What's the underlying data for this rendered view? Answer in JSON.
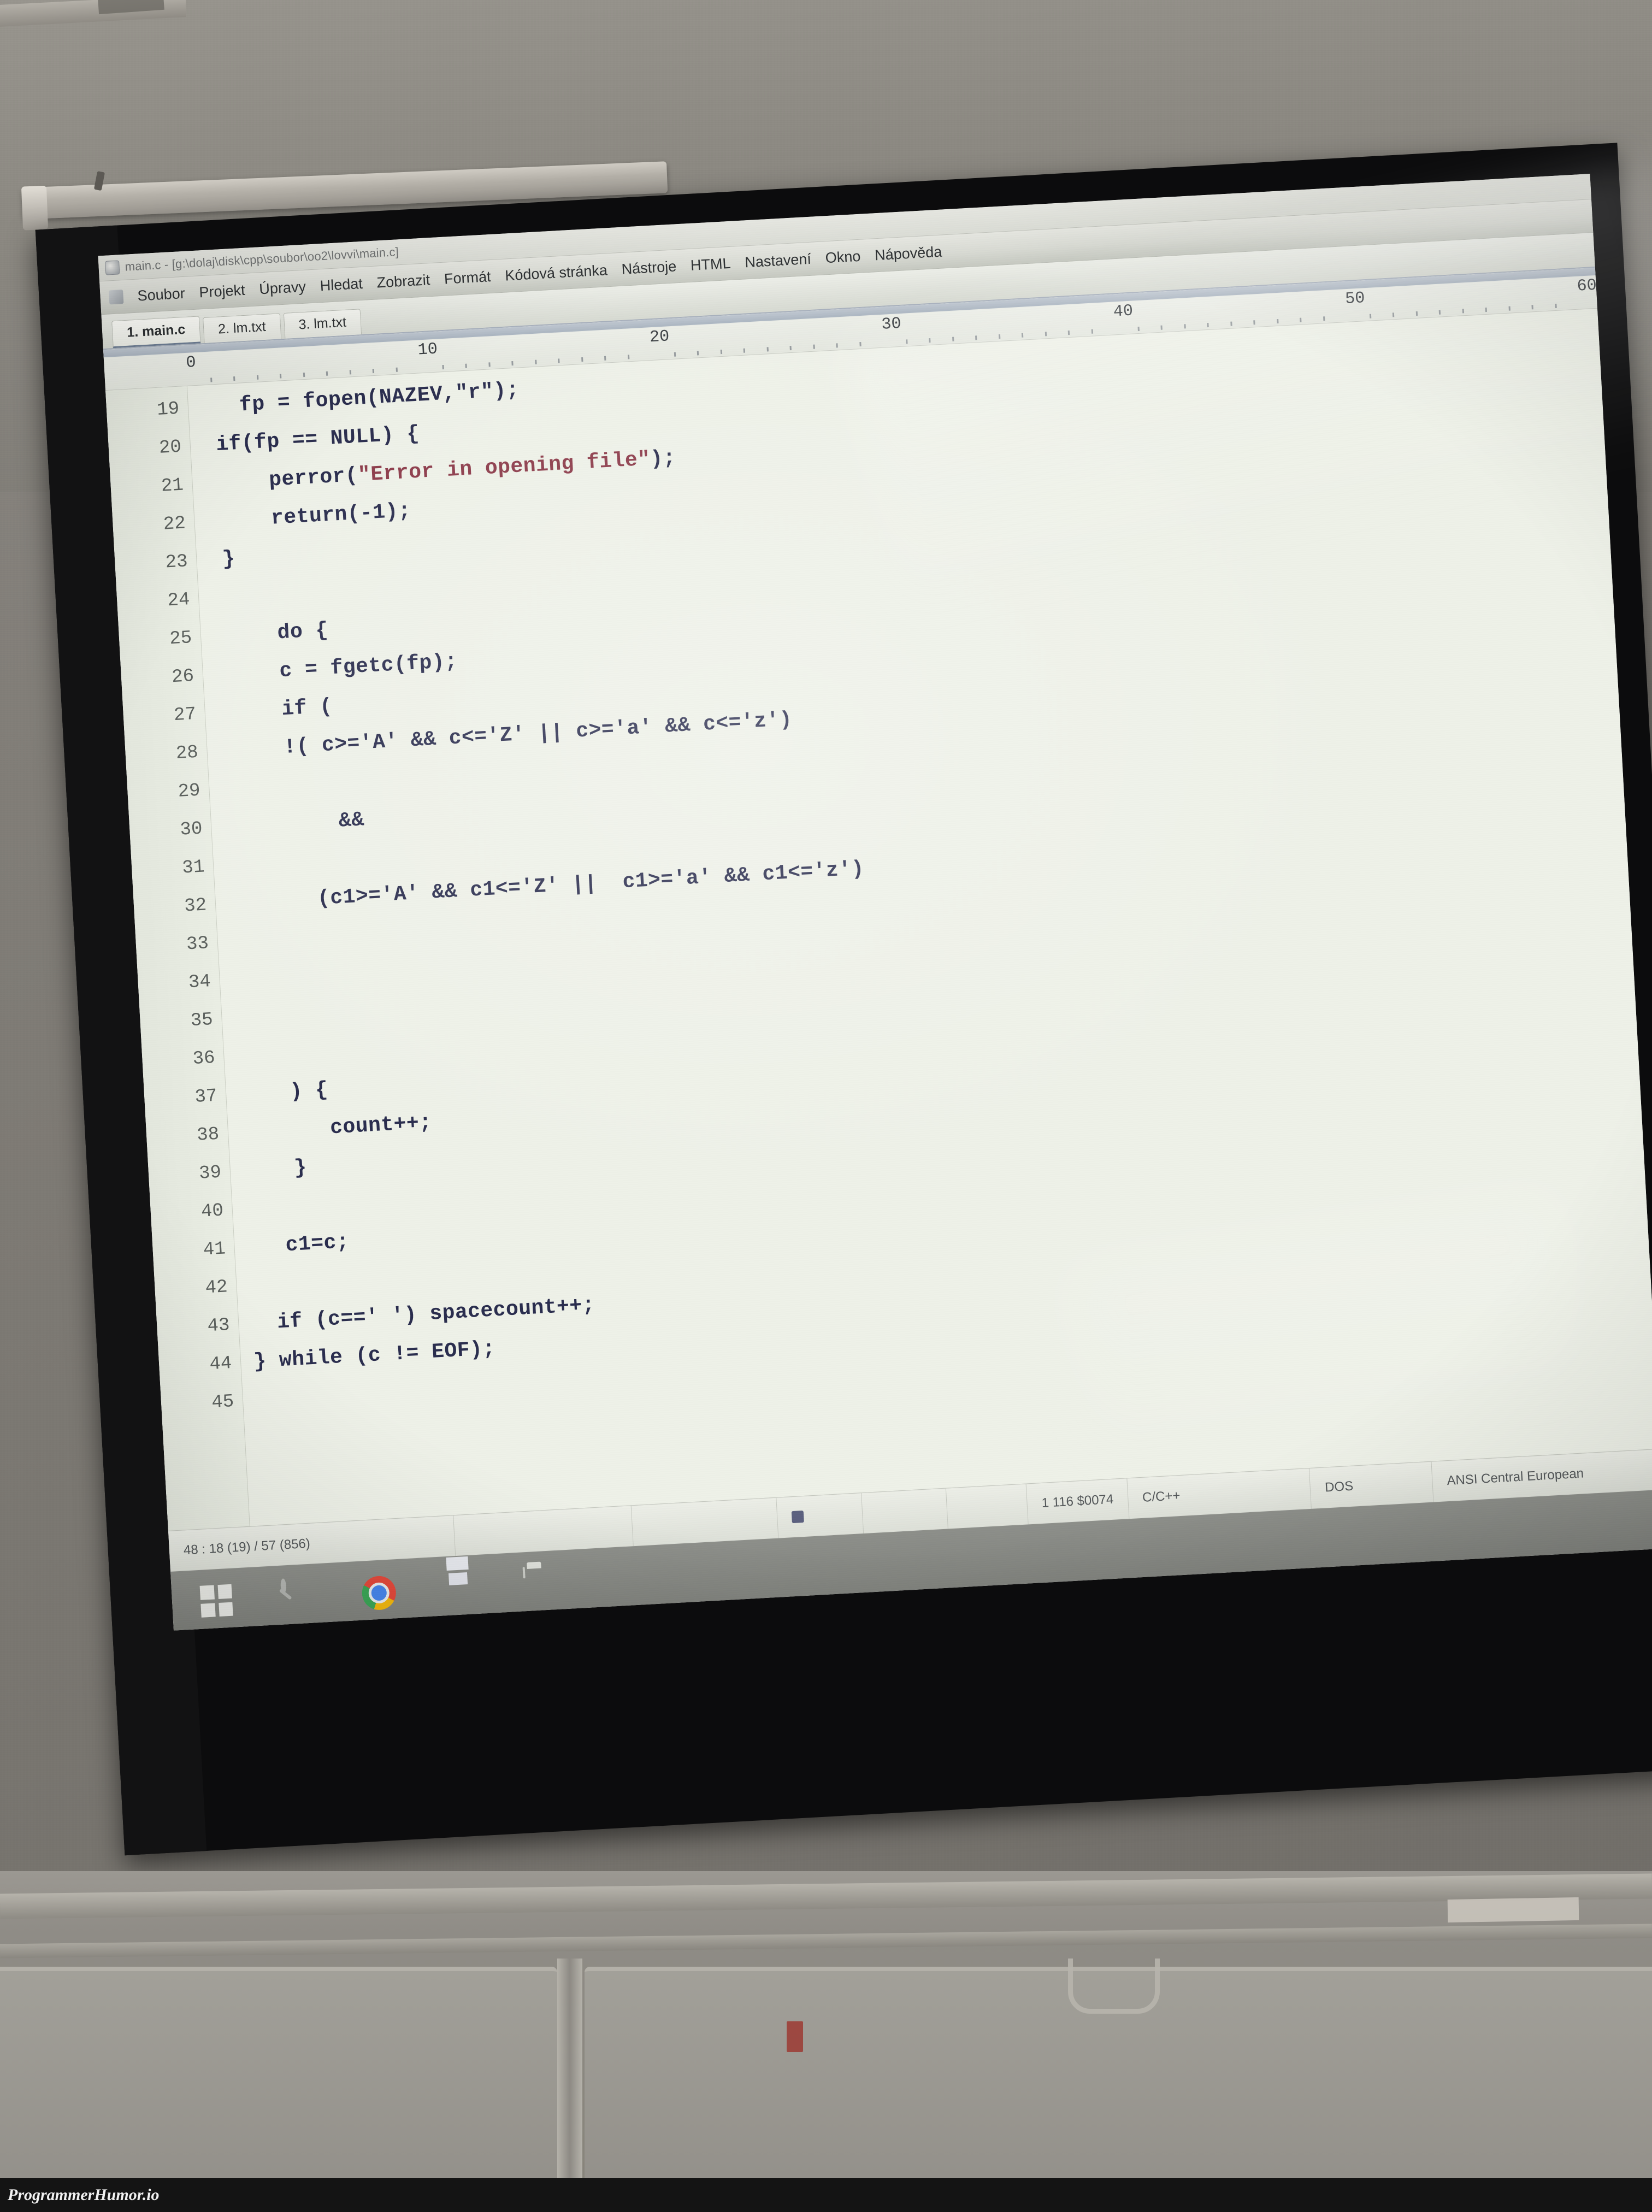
{
  "scene": {
    "description": "photo of a projector screen in a classroom showing PSPad editor",
    "watermark": "ProgrammerHumor.io"
  },
  "window": {
    "title": "main.c - [g:\\dolaj\\disk\\cpp\\soubor\\oo2\\lovvi\\main.c]",
    "icon": "pspad-icon"
  },
  "menubar": {
    "icon": "app-menu-icon",
    "items": [
      {
        "label": "Soubor"
      },
      {
        "label": "Projekt"
      },
      {
        "label": "Úpravy"
      },
      {
        "label": "Hledat"
      },
      {
        "label": "Zobrazit"
      },
      {
        "label": "Formát"
      },
      {
        "label": "Kódová stránka"
      },
      {
        "label": "Nástroje"
      },
      {
        "label": "HTML"
      },
      {
        "label": "Nastavení"
      },
      {
        "label": "Okno"
      },
      {
        "label": "Nápověda"
      }
    ]
  },
  "tabs": [
    {
      "label": "1. main.c",
      "active": true
    },
    {
      "label": "2. lm.txt",
      "active": false
    },
    {
      "label": "3. lm.txt",
      "active": false
    }
  ],
  "ruler": {
    "ticks": [
      "0",
      "10",
      "20",
      "30",
      "40",
      "50",
      "60"
    ]
  },
  "editor": {
    "lines": [
      {
        "num": "19",
        "text": "    fp = fopen(NAZEV,\"r\");"
      },
      {
        "num": "20",
        "text": "  if(fp == NULL) {"
      },
      {
        "num": "21",
        "text": "      perror(\"Error in opening file\");",
        "string_from": 13,
        "string_to": 36
      },
      {
        "num": "22",
        "text": "      return(-1);"
      },
      {
        "num": "23",
        "text": "  }"
      },
      {
        "num": "24",
        "text": ""
      },
      {
        "num": "25",
        "text": "      do {"
      },
      {
        "num": "26",
        "text": "      c = fgetc(fp);"
      },
      {
        "num": "27",
        "text": "      if ("
      },
      {
        "num": "28",
        "text": "      !( c>='A' && c<='Z' || c>='a' && c<='z')"
      },
      {
        "num": "29",
        "text": ""
      },
      {
        "num": "30",
        "text": "          &&"
      },
      {
        "num": "31",
        "text": ""
      },
      {
        "num": "32",
        "text": "        (c1>='A' && c1<='Z' ||  c1>='a' && c1<='z')"
      },
      {
        "num": "33",
        "text": ""
      },
      {
        "num": "34",
        "text": ""
      },
      {
        "num": "35",
        "text": ""
      },
      {
        "num": "36",
        "text": ""
      },
      {
        "num": "37",
        "text": "     ) {"
      },
      {
        "num": "38",
        "text": "        count++;"
      },
      {
        "num": "39",
        "text": "     }"
      },
      {
        "num": "40",
        "text": ""
      },
      {
        "num": "41",
        "text": "    c1=c;"
      },
      {
        "num": "42",
        "text": ""
      },
      {
        "num": "43",
        "text": "   if (c==' ') spacecount++;"
      },
      {
        "num": "44",
        "text": " } while (c != EOF);"
      },
      {
        "num": "45",
        "text": ""
      }
    ]
  },
  "statusbar": {
    "cursor": "48 : 18 (19) / 57 (856)",
    "modified_icon": "modified-icon",
    "position": "1  116  $0074",
    "language": "C/C++",
    "line_ending": "DOS",
    "encoding": "ANSI Central European"
  },
  "taskbar": {
    "items": [
      {
        "name": "start-button",
        "icon": "windows-logo-icon"
      },
      {
        "name": "search-button",
        "icon": "search-icon"
      },
      {
        "name": "chrome-button",
        "icon": "chrome-icon"
      },
      {
        "name": "pspad-button",
        "icon": "floppy-disk-icon"
      },
      {
        "name": "explorer-button",
        "icon": "folder-icon"
      },
      {
        "name": "security-button",
        "icon": "shield-icon"
      }
    ]
  }
}
